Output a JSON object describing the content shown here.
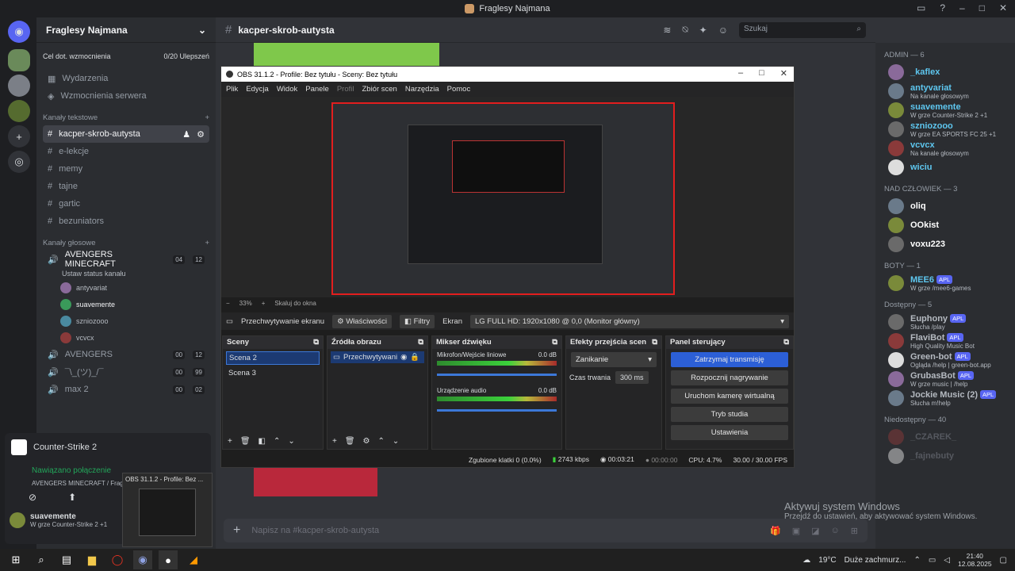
{
  "window": {
    "title": "Fraglesy Najmana"
  },
  "server": {
    "name": "Fraglesy Najmana",
    "boost_label": "Cel dot. wzmocnienia",
    "boost_progress": "0/20 Ulepszeń",
    "events": "Wydarzenia",
    "boosts": "Wzmocnienia serwera"
  },
  "text_category": "Kanały tekstowe",
  "text_channels": [
    "kacper-skrob-autysta",
    "e-lekcje",
    "memy",
    "tajne",
    "gartic",
    "bezuniators"
  ],
  "voice_category": "Kanały głosowe",
  "voice_channels": [
    {
      "name": "AVENGERS MINECRAFT",
      "count1": "04",
      "count2": "12",
      "status": "Ustaw status kanału",
      "users": [
        "antyvariat",
        "suavemente",
        "szniozooo",
        "vcvcx"
      ]
    },
    {
      "name": "AVENGERS",
      "count1": "00",
      "count2": "12"
    },
    {
      "name": "¯\\_(ツ)_/¯",
      "count1": "00",
      "count2": "99"
    },
    {
      "name": "max 2",
      "count1": "00",
      "count2": "02"
    }
  ],
  "chat": {
    "channel": "kacper-skrob-autysta",
    "placeholder": "Napisz na #kacper-skrob-autysta",
    "search": "Szukaj"
  },
  "obs": {
    "title": "OBS 31.1.2 - Profile: Bez tytułu - Sceny: Bez tytułu",
    "menu": [
      "Plik",
      "Edycja",
      "Widok",
      "Panele",
      "Profil",
      "Zbiór scen",
      "Narzędzia",
      "Pomoc"
    ],
    "zoom": "33%",
    "scale": "Skaluj do okna",
    "source_name": "Przechwytywanie ekranu",
    "props": "Właściwości",
    "filters": "Filtry",
    "screen_label": "Ekran",
    "screen_value": "LG FULL HD: 1920x1080 @ 0,0 (Monitor główny)",
    "docks": {
      "scenes": "Sceny",
      "sources": "Źródła obrazu",
      "mixer": "Mikser dźwięku",
      "transitions": "Efekty przejścia scen",
      "controls": "Panel sterujący"
    },
    "scenes": [
      "Scena 2",
      "Scena 3"
    ],
    "source_item": "Przechwytywani",
    "mixer": [
      {
        "name": "Mikrofon/Wejście liniowe",
        "db": "0.0 dB"
      },
      {
        "name": "Urządzenie audio",
        "db": "0.0 dB"
      }
    ],
    "transition": "Zanikanie",
    "duration_label": "Czas trwania",
    "duration": "300 ms",
    "controls": [
      "Zatrzymaj transmisję",
      "Rozpocznij nagrywanie",
      "Uruchom kamerę wirtualną",
      "Tryb studia",
      "Ustawienia"
    ],
    "status": {
      "dropped": "Zgubione klatki 0 (0.0%)",
      "kbps": "2743 kbps",
      "live": "00:03:21",
      "rec": "00:00:00",
      "cpu": "CPU: 4.7%",
      "fps": "30.00 / 30.00 FPS"
    }
  },
  "members": {
    "groups": [
      {
        "label": "ADMIN — 6",
        "items": [
          {
            "name": "_kaflex",
            "sub": "",
            "color": "#5ec7f0"
          },
          {
            "name": "antyvariat",
            "sub": "Na kanale głosowym",
            "color": "#5ec7f0"
          },
          {
            "name": "suavemente",
            "sub": "W grze Counter-Strike 2 +1",
            "color": "#5ec7f0"
          },
          {
            "name": "szniozooo",
            "sub": "W grze EA SPORTS FC 25 +1",
            "color": "#5ec7f0"
          },
          {
            "name": "vcvcx",
            "sub": "Na kanale głosowym",
            "color": "#5ec7f0"
          },
          {
            "name": "wiciu",
            "sub": "",
            "color": "#5ec7f0"
          }
        ]
      },
      {
        "label": "NAD CZŁOWIEK — 3",
        "items": [
          {
            "name": "oliq",
            "sub": "",
            "color": "#ffffff"
          },
          {
            "name": "OOkist",
            "sub": "",
            "color": "#ffffff"
          },
          {
            "name": "voxu223",
            "sub": "",
            "color": "#ffffff"
          }
        ]
      },
      {
        "label": "BOTY — 1",
        "items": [
          {
            "name": "MEE6",
            "sub": "W grze /mee6-games",
            "color": "#5ec7f0",
            "apl": "APL"
          }
        ]
      },
      {
        "label": "Dostępny — 5",
        "items": [
          {
            "name": "Euphony",
            "sub": "Słucha /play",
            "color": "#b5bac1",
            "apl": "APL"
          },
          {
            "name": "FlaviBot",
            "sub": "High Quality Music Bot",
            "color": "#b5bac1",
            "apl": "APL"
          },
          {
            "name": "Green-bot",
            "sub": "Ogląda /help | green-bot.app",
            "color": "#b5bac1",
            "apl": "APL"
          },
          {
            "name": "GrubasBot",
            "sub": "W grze music | /help",
            "color": "#b5bac1",
            "apl": "APL"
          },
          {
            "name": "Jockie Music (2)",
            "sub": "Słucha m!help",
            "color": "#b5bac1",
            "apl": "APL"
          }
        ]
      },
      {
        "label": "Niedostępny — 40",
        "items": [
          {
            "name": "_CZAREK_",
            "sub": "",
            "color": "#80848e"
          },
          {
            "name": "_fajnebuty",
            "sub": "",
            "color": "#80848e"
          }
        ]
      }
    ]
  },
  "cs": {
    "game": "Counter-Strike 2",
    "conn": "Nawiązano połączenie",
    "conn_sub": "AVENGERS MINECRAFT / Fragle",
    "user": "suavemente",
    "user_sub": "W grze Counter-Strike 2 +1"
  },
  "thumb": {
    "title": "OBS 31.1.2 - Profile: Bez ..."
  },
  "watermark": {
    "title": "Aktywuj system Windows",
    "sub": "Przejdź do ustawień, aby aktywować system Windows."
  },
  "taskbar": {
    "weather": "19°C",
    "weather_desc": "Duże zachmurz...",
    "time": "21:40",
    "date": "12.08.2025"
  }
}
